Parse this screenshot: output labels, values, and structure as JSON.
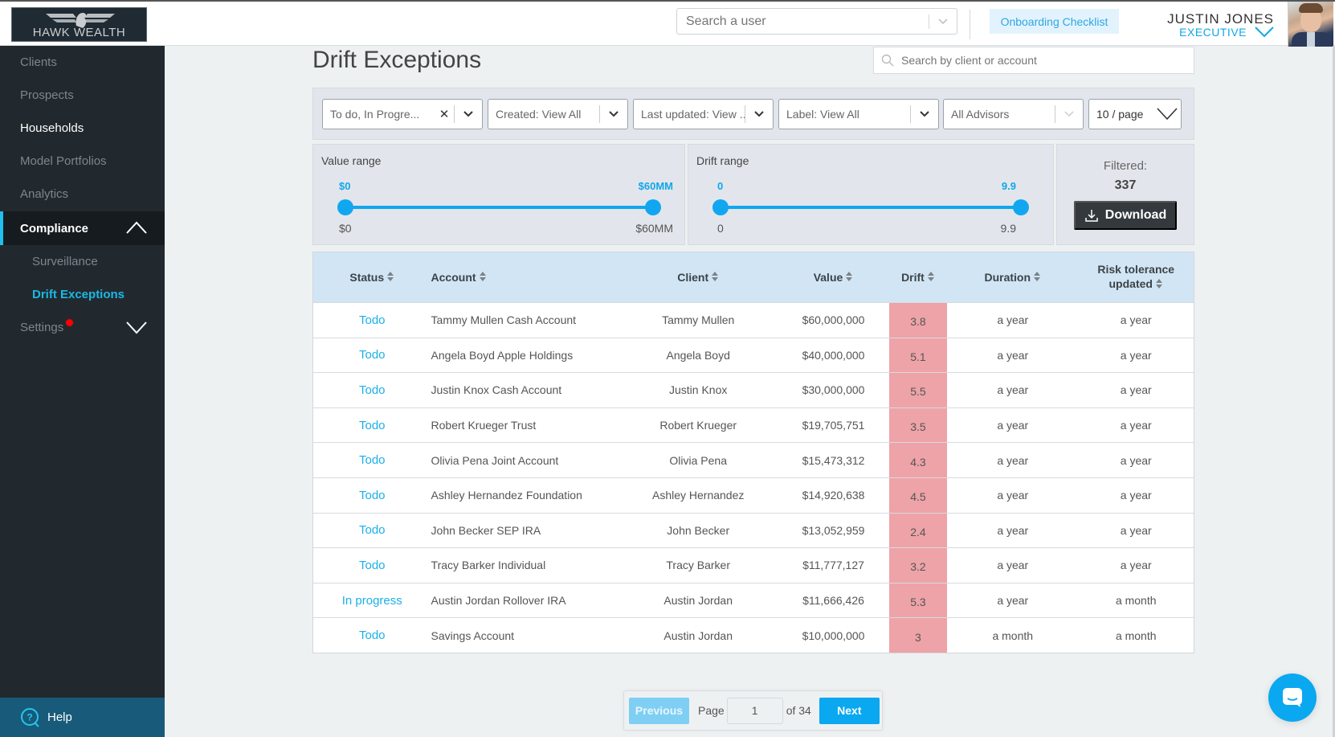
{
  "app": {
    "logo_text": "HAWK WEALTH"
  },
  "header": {
    "user_search_placeholder": "Search a user",
    "onboarding_label": "Onboarding Checklist",
    "user_name": "JUSTIN JONES",
    "user_role": "EXECUTIVE"
  },
  "sidebar": {
    "items": [
      {
        "label": "Clients"
      },
      {
        "label": "Prospects"
      },
      {
        "label": "Households"
      },
      {
        "label": "Model Portfolios"
      },
      {
        "label": "Analytics"
      },
      {
        "label": "Compliance"
      },
      {
        "label": "Surveillance"
      },
      {
        "label": "Drift Exceptions"
      },
      {
        "label": "Settings"
      }
    ],
    "help_label": "Help"
  },
  "page": {
    "title": "Drift Exceptions",
    "search_placeholder": "Search by client or account"
  },
  "filters": {
    "status": "To do, In Progre...",
    "created": "Created: View All",
    "last_updated": "Last updated: View ...",
    "label": "Label: View All",
    "advisors": "All Advisors",
    "page_size": "10 / page"
  },
  "value_range": {
    "title": "Value range",
    "selected_min": "$0",
    "selected_max": "$60MM",
    "min": "$0",
    "max": "$60MM",
    "selected_fraction": [
      0,
      1
    ]
  },
  "drift_range": {
    "title": "Drift range",
    "selected_min": "0",
    "selected_max": "9.9",
    "min": "0",
    "max": "9.9",
    "selected_fraction": [
      0,
      1
    ]
  },
  "summary": {
    "filtered_label": "Filtered:",
    "filtered_count": "337",
    "download_label": "Download"
  },
  "table": {
    "columns": [
      "Status",
      "Account",
      "Client",
      "Value",
      "Drift",
      "Duration",
      "Risk tolerance updated"
    ],
    "rows": [
      {
        "status": "Todo",
        "account": "Tammy Mullen Cash Account",
        "client": "Tammy Mullen",
        "value": "$60,000,000",
        "drift": "3.8",
        "duration": "a year",
        "risk": "a year"
      },
      {
        "status": "Todo",
        "account": "Angela Boyd Apple Holdings",
        "client": "Angela Boyd",
        "value": "$40,000,000",
        "drift": "5.1",
        "duration": "a year",
        "risk": "a year"
      },
      {
        "status": "Todo",
        "account": "Justin Knox Cash Account",
        "client": "Justin Knox",
        "value": "$30,000,000",
        "drift": "5.5",
        "duration": "a year",
        "risk": "a year"
      },
      {
        "status": "Todo",
        "account": "Robert Krueger Trust",
        "client": "Robert Krueger",
        "value": "$19,705,751",
        "drift": "3.5",
        "duration": "a year",
        "risk": "a year"
      },
      {
        "status": "Todo",
        "account": "Olivia Pena Joint Account",
        "client": "Olivia Pena",
        "value": "$15,473,312",
        "drift": "4.3",
        "duration": "a year",
        "risk": "a year"
      },
      {
        "status": "Todo",
        "account": "Ashley Hernandez Foundation",
        "client": "Ashley Hernandez",
        "value": "$14,920,638",
        "drift": "4.5",
        "duration": "a year",
        "risk": "a year"
      },
      {
        "status": "Todo",
        "account": "John Becker SEP IRA",
        "client": "John Becker",
        "value": "$13,052,959",
        "drift": "2.4",
        "duration": "a year",
        "risk": "a year"
      },
      {
        "status": "Todo",
        "account": "Tracy Barker Individual",
        "client": "Tracy Barker",
        "value": "$11,777,127",
        "drift": "3.2",
        "duration": "a year",
        "risk": "a year"
      },
      {
        "status": "In progress",
        "account": "Austin Jordan Rollover IRA",
        "client": "Austin Jordan",
        "value": "$11,666,426",
        "drift": "5.3",
        "duration": "a year",
        "risk": "a month"
      },
      {
        "status": "Todo",
        "account": "Savings Account",
        "client": "Austin Jordan",
        "value": "$10,000,000",
        "drift": "3",
        "duration": "a month",
        "risk": "a month"
      }
    ]
  },
  "pagination": {
    "previous_label": "Previous",
    "page_label": "Page",
    "current_page": "1",
    "of_label": "of 34",
    "next_label": "Next"
  },
  "colors": {
    "accent": "#11a7f0",
    "sidebar_bg": "#22292e",
    "drift_highlight": "#eda3a8",
    "header_row": "#d1e5f5"
  }
}
